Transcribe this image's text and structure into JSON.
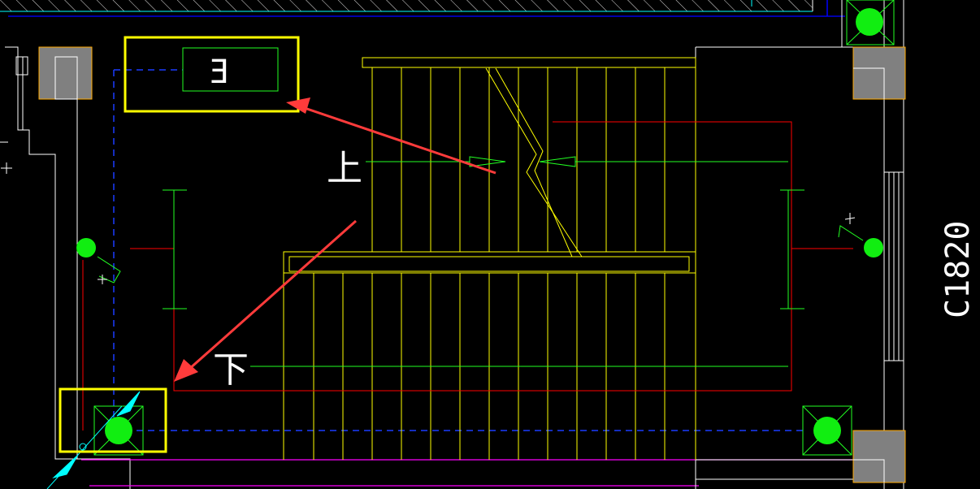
{
  "drawing": {
    "background": "#000000",
    "window_label": "C1820",
    "stair_up_label": "上",
    "stair_down_label": "下",
    "outlet_label": "E"
  },
  "highlights": {
    "outlet_box": {
      "color": "#ffff00",
      "role": "highlight"
    },
    "column_box": {
      "color": "#ffff00",
      "role": "highlight"
    }
  },
  "annotations": {
    "arrow_color": "#ff3b3b"
  },
  "layer_colors": {
    "wall": "#ffffff",
    "stair": "#ffff00",
    "electrical": "#00ff00",
    "wiring": "#ff0000",
    "axis": "#0000ff",
    "column": "#808080",
    "marker": "#00ffff",
    "boundary": "#ff00ff"
  }
}
